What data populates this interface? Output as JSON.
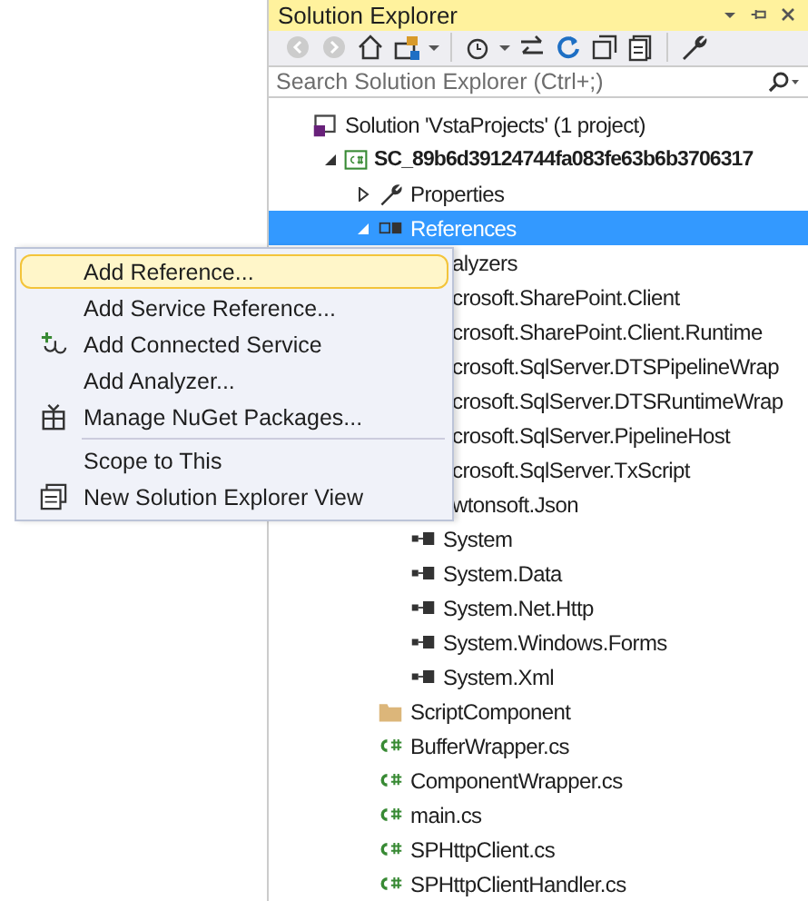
{
  "panel": {
    "title": "Solution Explorer"
  },
  "search": {
    "placeholder": "Search Solution Explorer (Ctrl+;)"
  },
  "tree": {
    "items": [
      {
        "label": "Solution 'VstaProjects' (1 project)",
        "kind": "solution",
        "selected": false,
        "children": [
          {
            "label": "SC_89b6d39124744fa083fe63b6b3706317",
            "kind": "project",
            "expanded": true,
            "selected": false,
            "children": [
              {
                "label": "Properties",
                "kind": "wrench",
                "expanded": false,
                "selected": false
              },
              {
                "label": "References",
                "kind": "references",
                "expanded": true,
                "selected": true,
                "children": [
                  {
                    "label": "alyzers",
                    "kind": "cut",
                    "selected": false
                  },
                  {
                    "label": "crosoft.SharePoint.Client",
                    "kind": "cut",
                    "selected": false
                  },
                  {
                    "label": "crosoft.SharePoint.Client.Runtime",
                    "kind": "cut",
                    "selected": false
                  },
                  {
                    "label": "crosoft.SqlServer.DTSPipelineWrap",
                    "kind": "cut",
                    "selected": false
                  },
                  {
                    "label": "crosoft.SqlServer.DTSRuntimeWrap",
                    "kind": "cut",
                    "selected": false
                  },
                  {
                    "label": "crosoft.SqlServer.PipelineHost",
                    "kind": "cut",
                    "selected": false
                  },
                  {
                    "label": "crosoft.SqlServer.TxScript",
                    "kind": "cut",
                    "selected": false
                  },
                  {
                    "label": "wtonsoft.Json",
                    "kind": "cut",
                    "selected": false
                  },
                  {
                    "label": "System",
                    "kind": "assembly",
                    "selected": false
                  },
                  {
                    "label": "System.Data",
                    "kind": "assembly",
                    "selected": false
                  },
                  {
                    "label": "System.Net.Http",
                    "kind": "assembly",
                    "selected": false
                  },
                  {
                    "label": "System.Windows.Forms",
                    "kind": "assembly",
                    "selected": false
                  },
                  {
                    "label": "System.Xml",
                    "kind": "assembly",
                    "selected": false
                  }
                ]
              },
              {
                "label": "ScriptComponent",
                "kind": "folder",
                "selected": false
              },
              {
                "label": "BufferWrapper.cs",
                "kind": "csharp",
                "selected": false
              },
              {
                "label": "ComponentWrapper.cs",
                "kind": "csharp",
                "selected": false
              },
              {
                "label": "main.cs",
                "kind": "csharp",
                "selected": false
              },
              {
                "label": "SPHttpClient.cs",
                "kind": "csharp",
                "selected": false
              },
              {
                "label": "SPHttpClientHandler.cs",
                "kind": "csharp",
                "selected": false
              }
            ]
          }
        ]
      }
    ]
  },
  "context_menu": {
    "items": [
      {
        "kind": "item",
        "label": "Add Reference...",
        "selected": true
      },
      {
        "kind": "item",
        "label": "Add Service Reference...",
        "selected": false
      },
      {
        "kind": "connected",
        "label": "Add Connected Service",
        "selected": false
      },
      {
        "kind": "item",
        "label": "Add Analyzer...",
        "selected": false
      },
      {
        "kind": "nuget",
        "label": "Manage NuGet Packages...",
        "selected": false
      },
      {
        "kind": "separator"
      },
      {
        "kind": "item",
        "label": "Scope to This",
        "selected": false
      },
      {
        "kind": "newview",
        "label": "New Solution Explorer View",
        "selected": false
      }
    ]
  }
}
